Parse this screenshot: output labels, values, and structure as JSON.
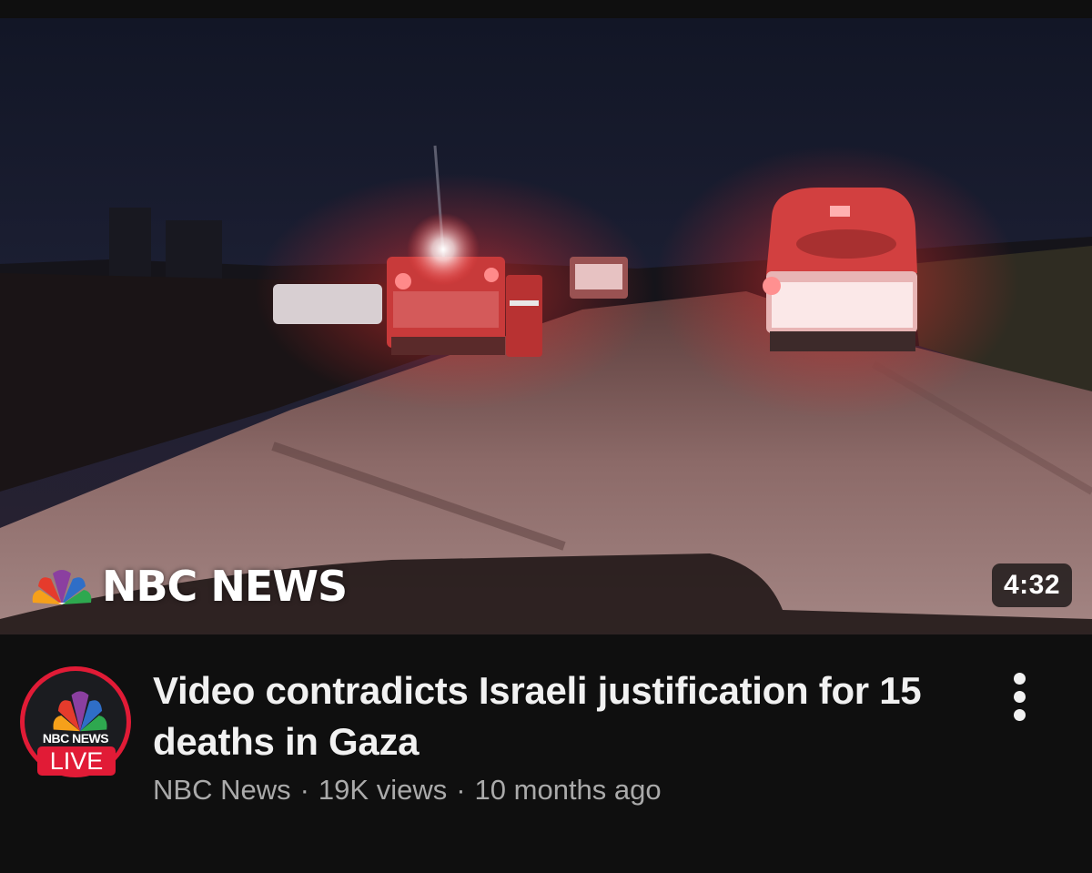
{
  "video": {
    "thumbnail": {
      "watermark": "NBC NEWS",
      "duration": "4:32"
    },
    "title": "Video contradicts Israeli justification for 15 deaths in Gaza",
    "channel": {
      "name": "NBC News",
      "avatar_text": "NBC NEWS",
      "avatar_badge": "LIVE"
    },
    "views": "19K views",
    "age": "10 months ago",
    "separator": "·"
  },
  "icons": {
    "menu": "more-vert-icon",
    "logo": "nbc-peacock-icon"
  },
  "colors": {
    "background": "#0f0f0f",
    "title": "#f1f1f1",
    "meta": "#aaaaaa",
    "live_red": "#e11b36"
  }
}
